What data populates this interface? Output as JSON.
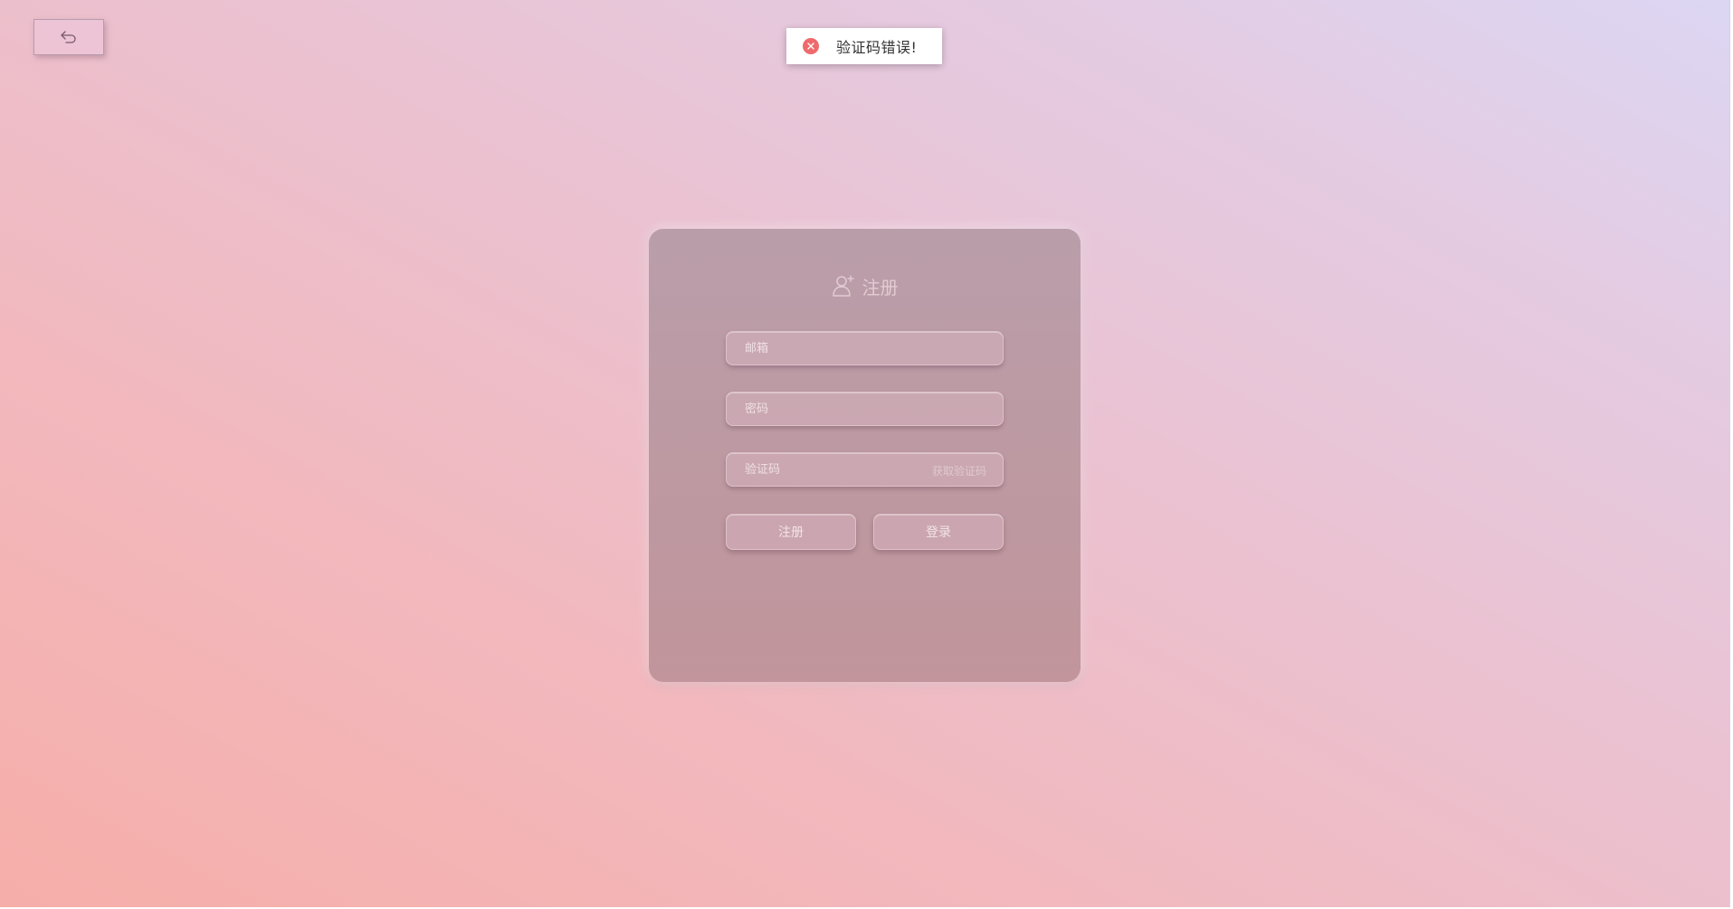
{
  "back_button": {
    "icon": "undo-arrow-icon"
  },
  "toast": {
    "icon": "error-circle-icon",
    "message": "验证码错误!"
  },
  "register_card": {
    "title": "注册",
    "title_icon": "user-plus-icon",
    "email": {
      "placeholder": "邮箱",
      "value": ""
    },
    "password": {
      "placeholder": "密码",
      "value": ""
    },
    "code": {
      "placeholder": "验证码",
      "value": "",
      "get_code_label": "获取验证码"
    },
    "register_label": "注册",
    "login_label": "登录"
  },
  "colors": {
    "error": "#ee6a6d",
    "card": "#bc9aa4",
    "text_light": "#f2e4e8"
  }
}
